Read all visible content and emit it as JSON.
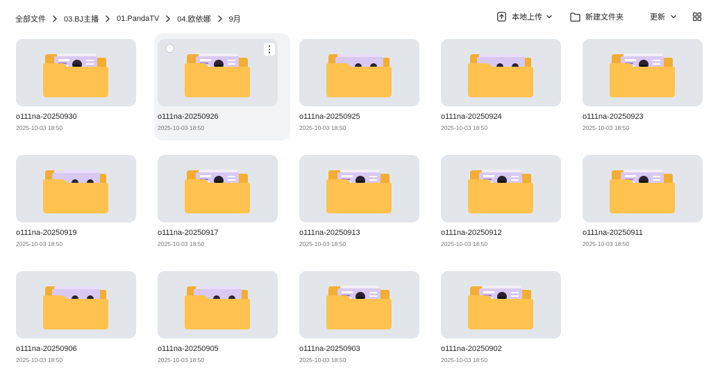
{
  "breadcrumb": [
    "全部文件",
    "03.BJ主播",
    "01.PandaTV",
    "04.欧依娜",
    "9月"
  ],
  "toolbar": {
    "upload_label": "本地上传",
    "new_folder_label": "新建文件夹",
    "sort_label": "更新",
    "upload_icon": "upload-icon",
    "new_folder_icon": "folder-add-icon",
    "sort_icon": "chevron-down-icon",
    "view_icon": "grid-view-icon"
  },
  "folders": [
    {
      "name": "o111na-20250930",
      "date": "2025-10-03 18:50",
      "thumb": "card"
    },
    {
      "name": "o111na-20250926",
      "date": "2025-10-03 18:50",
      "thumb": "card",
      "hovered": true
    },
    {
      "name": "o111na-20250925",
      "date": "2025-10-03 18:50",
      "thumb": "triple"
    },
    {
      "name": "o111na-20250924",
      "date": "2025-10-03 18:50",
      "thumb": "triple"
    },
    {
      "name": "o111na-20250923",
      "date": "2025-10-03 18:50",
      "thumb": "card"
    },
    {
      "name": "o111na-20250919",
      "date": "2025-10-03 18:50",
      "thumb": "triple"
    },
    {
      "name": "o111na-20250917",
      "date": "2025-10-03 18:50",
      "thumb": "card"
    },
    {
      "name": "o111na-20250913",
      "date": "2025-10-03 18:50",
      "thumb": "card"
    },
    {
      "name": "o111na-20250912",
      "date": "2025-10-03 18:50",
      "thumb": "card"
    },
    {
      "name": "o111na-20250911",
      "date": "2025-10-03 18:50",
      "thumb": "card"
    },
    {
      "name": "o111na-20250906",
      "date": "2025-10-03 18:50",
      "thumb": "triple"
    },
    {
      "name": "o111na-20250905",
      "date": "2025-10-03 18:50",
      "thumb": "triple"
    },
    {
      "name": "o111na-20250903",
      "date": "2025-10-03 18:50",
      "thumb": "card"
    },
    {
      "name": "o111na-20250902",
      "date": "2025-10-03 18:50",
      "thumb": "card"
    }
  ],
  "colors": {
    "folder": "#ffc24e",
    "folder_back": "#f4ad33",
    "preview": "#d8c9f2",
    "thumb_bg": "#e2e6ea"
  }
}
